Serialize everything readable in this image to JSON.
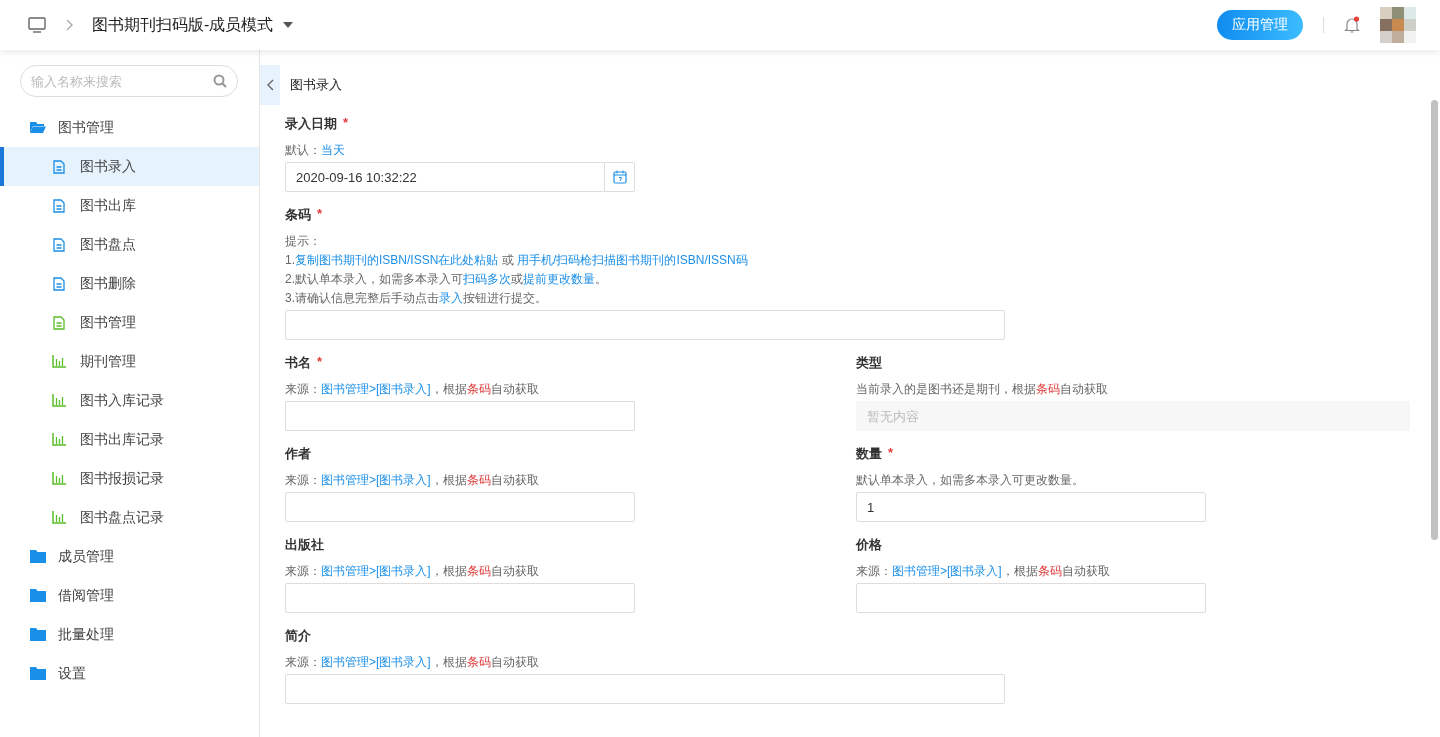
{
  "header": {
    "title": "图书期刊扫码版-成员模式",
    "button": "应用管理",
    "has_notification": true
  },
  "sidebar": {
    "search": {
      "placeholder": "输入名称来搜索"
    },
    "items": [
      {
        "label": "图书管理",
        "expanded": true,
        "selected": false,
        "children": [
          {
            "label": "图书录入",
            "kind": "doc",
            "selected": true
          },
          {
            "label": "图书出库",
            "kind": "doc",
            "selected": false
          },
          {
            "label": "图书盘点",
            "kind": "doc",
            "selected": false
          },
          {
            "label": "图书删除",
            "kind": "doc",
            "selected": false
          },
          {
            "label": "图书管理",
            "kind": "sheet",
            "selected": false
          },
          {
            "label": "期刊管理",
            "kind": "chart",
            "selected": false
          },
          {
            "label": "图书入库记录",
            "kind": "chart",
            "selected": false
          },
          {
            "label": "图书出库记录",
            "kind": "chart",
            "selected": false
          },
          {
            "label": "图书报损记录",
            "kind": "chart",
            "selected": false
          },
          {
            "label": "图书盘点记录",
            "kind": "chart",
            "selected": false
          }
        ]
      },
      {
        "label": "成员管理",
        "expanded": false,
        "selected": false
      },
      {
        "label": "借阅管理",
        "expanded": false,
        "selected": false
      },
      {
        "label": "批量处理",
        "expanded": false,
        "selected": false
      },
      {
        "label": "设置",
        "expanded": false,
        "selected": false
      }
    ]
  },
  "page": {
    "title": "图书录入"
  },
  "form": {
    "top": [
      {
        "label": "录入日期",
        "required_mark": "*",
        "kind": "date",
        "value": "2020-09-16 10:32:22",
        "hint": [
          [
            {
              "text": "默认：",
              "kind": "plain"
            },
            {
              "text": "当天",
              "kind": "link"
            }
          ]
        ]
      },
      {
        "label": "条码",
        "required_mark": "*",
        "kind": "wide",
        "hint": [
          [
            {
              "text": "提示：",
              "kind": "plain"
            }
          ],
          [
            {
              "text": "1.",
              "kind": "plain"
            },
            {
              "text": "复制图书期刊的ISBN/ISSN在此处粘贴",
              "kind": "link"
            },
            {
              "text": " 或 ",
              "kind": "plain"
            },
            {
              "text": "用手机/扫码枪扫描图书期刊的ISBN/ISSN码",
              "kind": "link"
            }
          ],
          [
            {
              "text": "2.默认单本录入，如需多本录入可",
              "kind": "plain"
            },
            {
              "text": "扫码多次",
              "kind": "link"
            },
            {
              "text": "或",
              "kind": "plain"
            },
            {
              "text": "提前更改数量",
              "kind": "link"
            },
            {
              "text": "。",
              "kind": "plain"
            }
          ],
          [
            {
              "text": "3.请确认信息完整后手动点击",
              "kind": "plain"
            },
            {
              "text": "录入",
              "kind": "link"
            },
            {
              "text": "按钮进行提交。",
              "kind": "plain"
            }
          ]
        ]
      }
    ],
    "left": [
      {
        "label": "书名",
        "required_mark": "*",
        "kind": "text",
        "hint": [
          [
            {
              "text": "来源：",
              "kind": "plain"
            },
            {
              "text": "图书管理>[图书录入]",
              "kind": "link"
            },
            {
              "text": "，根据",
              "kind": "plain"
            },
            {
              "text": "条码",
              "kind": "accent"
            },
            {
              "text": "自动获取",
              "kind": "plain"
            }
          ]
        ]
      },
      {
        "label": "作者",
        "kind": "text",
        "hint": [
          [
            {
              "text": "来源：",
              "kind": "plain"
            },
            {
              "text": "图书管理>[图书录入]",
              "kind": "link"
            },
            {
              "text": "，根据",
              "kind": "plain"
            },
            {
              "text": "条码",
              "kind": "accent"
            },
            {
              "text": "自动获取",
              "kind": "plain"
            }
          ]
        ]
      },
      {
        "label": "出版社",
        "kind": "text",
        "hint": [
          [
            {
              "text": "来源：",
              "kind": "plain"
            },
            {
              "text": "图书管理>[图书录入]",
              "kind": "link"
            },
            {
              "text": "，根据",
              "kind": "plain"
            },
            {
              "text": "条码",
              "kind": "accent"
            },
            {
              "text": "自动获取",
              "kind": "plain"
            }
          ]
        ]
      }
    ],
    "right": [
      {
        "label": "类型",
        "kind": "disabled",
        "placeholder": "暂无内容",
        "hint": [
          [
            {
              "text": "当前录入的是图书还是期刊，根据",
              "kind": "plain"
            },
            {
              "text": "条码",
              "kind": "accent"
            },
            {
              "text": "自动获取",
              "kind": "plain"
            }
          ]
        ]
      },
      {
        "label": "数量",
        "required_mark": "*",
        "kind": "text",
        "value": "1",
        "hint": [
          [
            {
              "text": "默认单本录入，如需多本录入可更改数量。",
              "kind": "plain"
            }
          ]
        ]
      },
      {
        "label": "价格",
        "kind": "text",
        "hint": [
          [
            {
              "text": "来源：",
              "kind": "plain"
            },
            {
              "text": "图书管理>[图书录入]",
              "kind": "link"
            },
            {
              "text": "，根据",
              "kind": "plain"
            },
            {
              "text": "条码",
              "kind": "accent"
            },
            {
              "text": "自动获取",
              "kind": "plain"
            }
          ]
        ]
      }
    ],
    "bottom": [
      {
        "label": "简介",
        "kind": "wide",
        "hint": [
          [
            {
              "text": "来源：",
              "kind": "plain"
            },
            {
              "text": "图书管理>[图书录入]",
              "kind": "link"
            },
            {
              "text": "，根据",
              "kind": "plain"
            },
            {
              "text": "条码",
              "kind": "accent"
            },
            {
              "text": "自动获取",
              "kind": "plain"
            }
          ]
        ]
      }
    ]
  }
}
